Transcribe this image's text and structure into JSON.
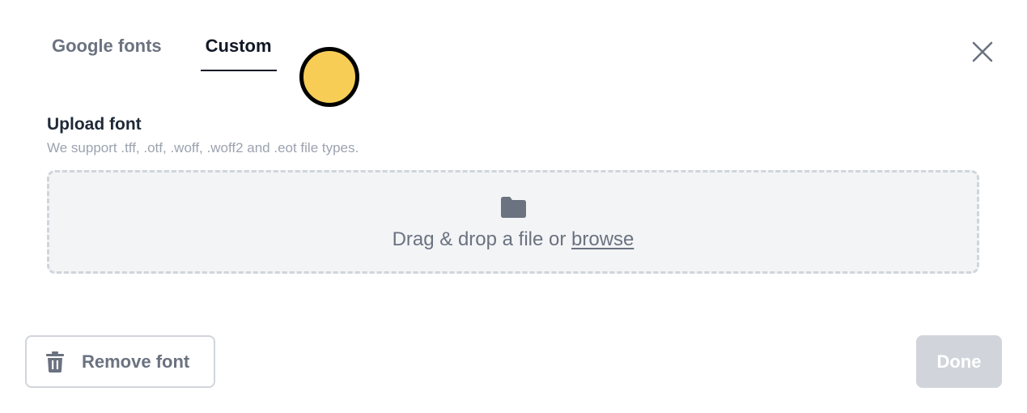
{
  "tabs": [
    {
      "label": "Google fonts",
      "active": false
    },
    {
      "label": "Custom",
      "active": true
    }
  ],
  "upload": {
    "title": "Upload font",
    "subtitle": "We support .tff, .otf, .woff, .woff2 and .eot file types.",
    "drop_text": "Drag & drop a file or ",
    "browse_label": "browse",
    "icon": "folder-icon"
  },
  "footer": {
    "remove_label": "Remove font",
    "remove_icon": "trash-icon",
    "done_label": "Done",
    "done_enabled": false
  },
  "close_icon": "close-icon",
  "colors": {
    "cursor_highlight": "#f7cd56",
    "dropzone_bg": "#f3f4f6",
    "disabled_button": "#d1d5db"
  }
}
